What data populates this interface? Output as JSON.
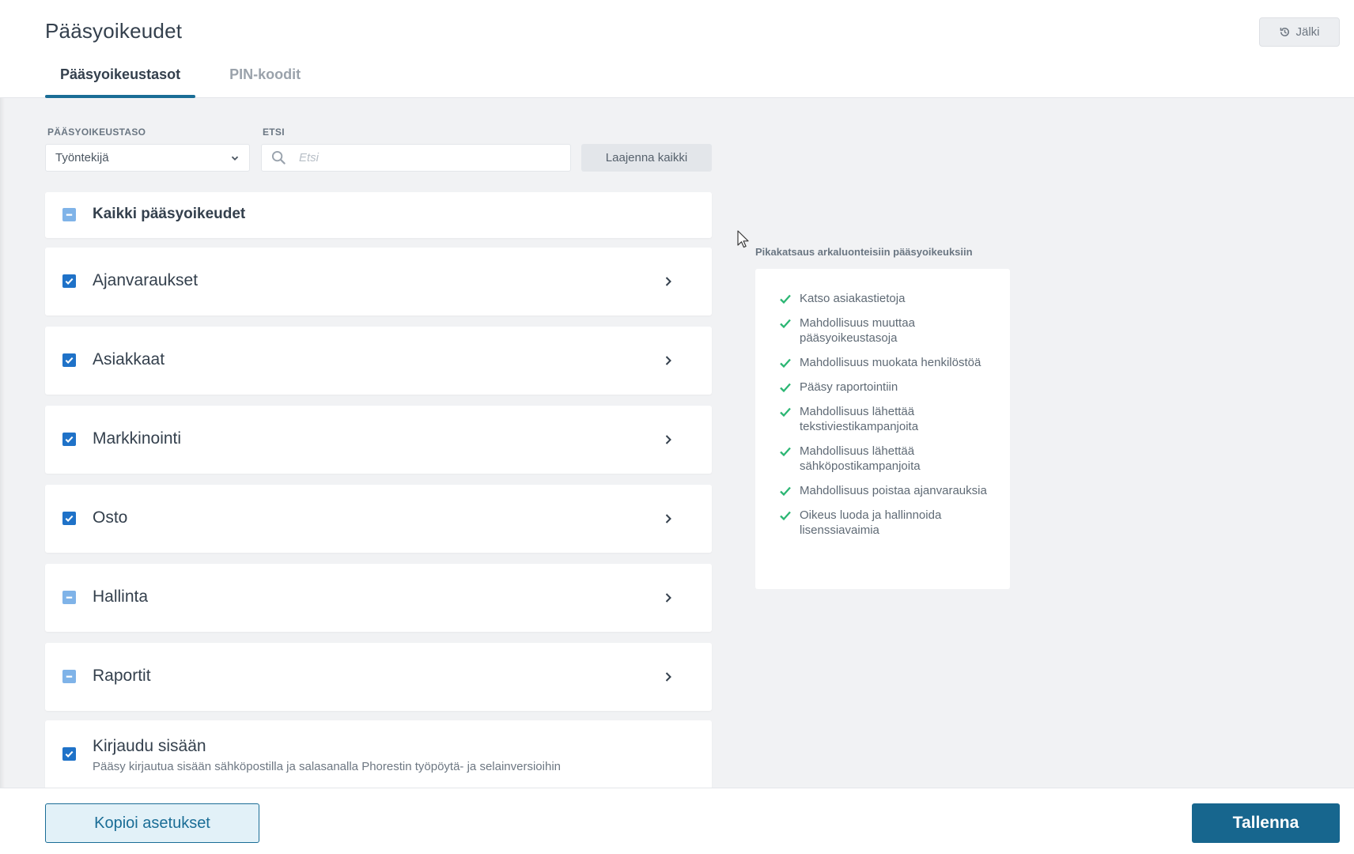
{
  "header": {
    "title": "Pääsyoikeudet",
    "history_label": "Jälki",
    "tabs": [
      {
        "label": "Pääsyoikeustasot",
        "active": true
      },
      {
        "label": "PIN-koodit",
        "active": false
      }
    ]
  },
  "filters": {
    "level_label": "PÄÄSYOIKEUSTASO",
    "level_value": "Työntekijä",
    "search_label": "ETSI",
    "search_placeholder": "Etsi",
    "search_value": "",
    "expand_all_label": "Laajenna kaikki"
  },
  "permissions": {
    "all_label": "Kaikki pääsyoikeudet",
    "all_state": "partial",
    "groups": [
      {
        "label": "Ajanvaraukset",
        "state": "checked"
      },
      {
        "label": "Asiakkaat",
        "state": "checked"
      },
      {
        "label": "Markkinointi",
        "state": "checked"
      },
      {
        "label": "Osto",
        "state": "checked"
      },
      {
        "label": "Hallinta",
        "state": "partial"
      },
      {
        "label": "Raportit",
        "state": "partial"
      }
    ],
    "login": {
      "label": "Kirjaudu sisään",
      "description": "Pääsy kirjautua sisään sähköpostilla ja salasanalla Phorestin työpöytä- ja selainversioihin",
      "state": "checked"
    }
  },
  "overview": {
    "title": "Pikakatsaus arkaluonteisiin pääsyoikeuksiin",
    "items": [
      "Katso asiakastietoja",
      "Mahdollisuus muuttaa pääsyoikeustasoja",
      "Mahdollisuus muokata henkilöstöä",
      "Pääsy raportointiin",
      "Mahdollisuus lähettää tekstiviestikampanjoita",
      "Mahdollisuus lähettää sähköpostikampanjoita",
      "Mahdollisuus poistaa ajanvarauksia",
      "Oikeus luoda ja hallinnoida lisenssiavaimia"
    ]
  },
  "footer": {
    "copy_label": "Kopioi asetukset",
    "save_label": "Tallenna"
  },
  "colors": {
    "primary": "#17668e",
    "checkbox_checked": "#1f72c8",
    "checkbox_partial": "#7fb3e8",
    "check_green": "#2bb673"
  }
}
